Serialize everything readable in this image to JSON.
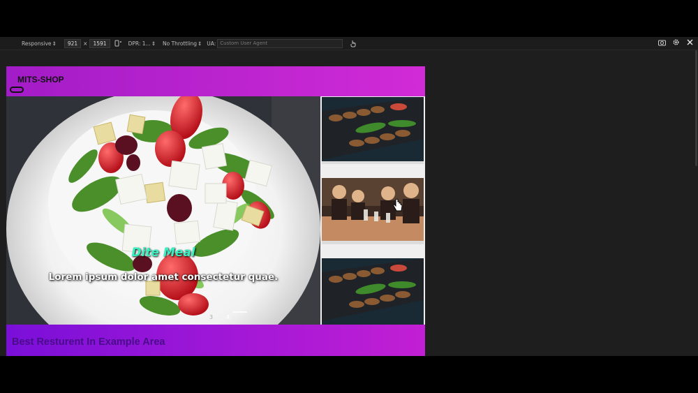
{
  "devtools": {
    "device_mode": "Responsive",
    "width": "921",
    "times": "×",
    "height": "1591",
    "dpr": "DPR: 1...",
    "throttling": "No Throttling",
    "ua_label": "UA:",
    "ua_placeholder": "Custom User Agent"
  },
  "site": {
    "brand": "MITS-SHOP",
    "carousel": {
      "title": "Dite Meal",
      "text": "Lorem ipsum dolor amet consectetur quae.",
      "indicators": [
        "3",
        "4."
      ]
    },
    "footer_heading": "Best Resturent In Example Area"
  },
  "colors": {
    "navbar": "#c326d3",
    "footer": "#9a17d8",
    "slide_title": "#39f0c0"
  }
}
